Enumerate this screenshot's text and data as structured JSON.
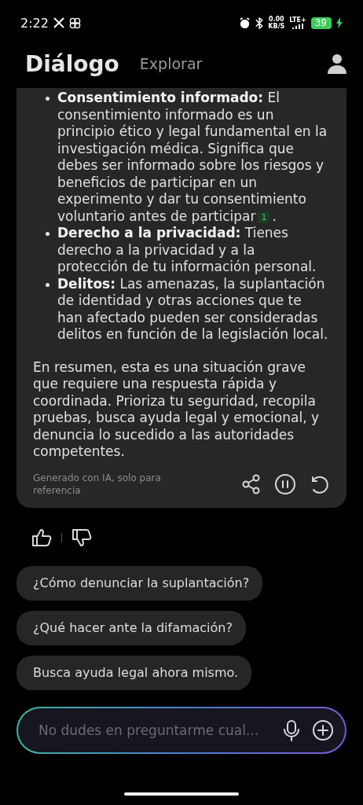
{
  "status_bar": {
    "time": "2:22",
    "net_speed": "0.00",
    "net_unit": "KB/S",
    "network": "LTE+",
    "battery": "39"
  },
  "tabs": [
    {
      "label": "Diálogo",
      "selected": true
    },
    {
      "label": "Explorar",
      "selected": false
    }
  ],
  "answer": {
    "bullets": [
      {
        "text": "**Consentimiento informado:**  El consentimiento informado es un principio ético y legal fundamental en la investigación médica. Significa que debes ser informado sobre los riesgos y beneficios de participar en un experimento y dar tu consentimiento voluntario antes de participar",
        "citation": "1",
        "suffix": "."
      },
      {
        "text": "**Derecho a la privacidad:** Tienes derecho a la privacidad y a la protección de tu información personal."
      },
      {
        "text": "**Delitos:** Las amenazas, la suplantación de identidad y otras acciones que te han afectado pueden ser consideradas delitos en función de la legislación local."
      }
    ],
    "summary": "En resumen, esta es una situación grave que requiere una respuesta rápida y coordinada. Prioriza tu seguridad, recopila pruebas, busca ayuda legal y emocional, y denuncia lo sucedido a las autoridades competentes.",
    "disclaimer": "Generado con IA, solo para referencia",
    "playing": true
  },
  "suggestions": [
    "¿Cómo denunciar la suplantación?",
    "¿Qué hacer ante la difamación?",
    "Busca ayuda legal ahora mismo."
  ],
  "input": {
    "placeholder": "No dudes en preguntarme cual..."
  }
}
